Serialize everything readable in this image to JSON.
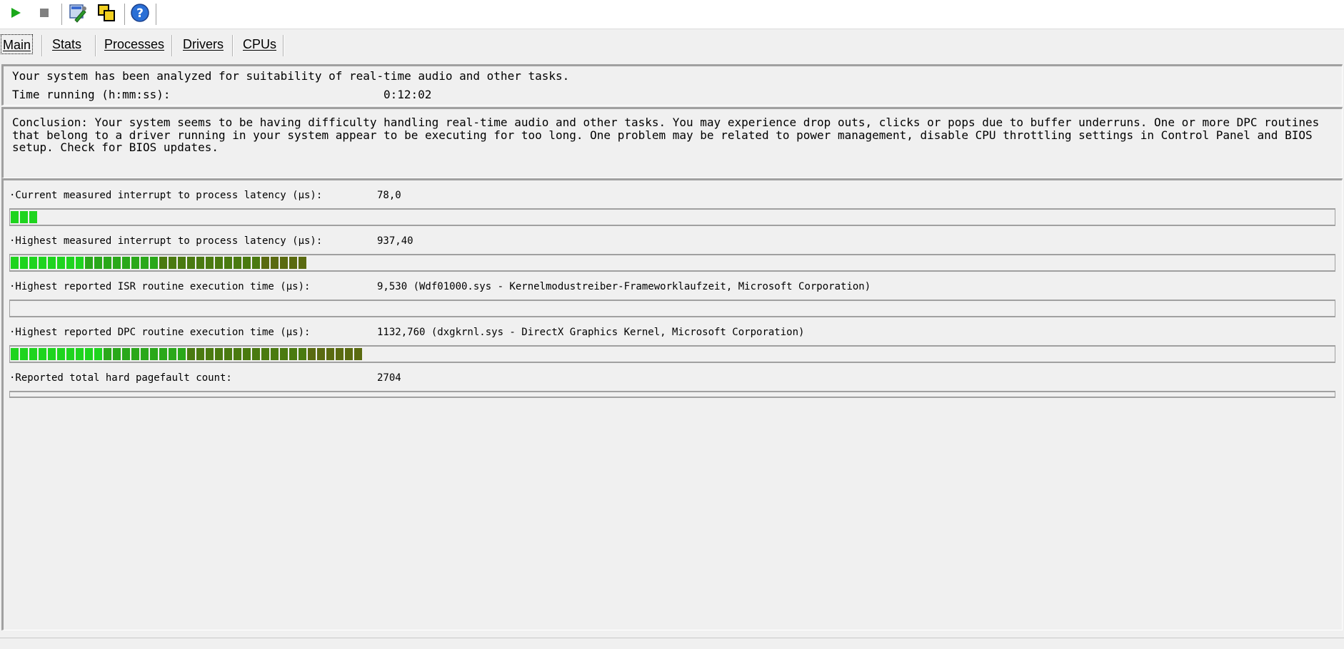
{
  "toolbar": {
    "icons": [
      "play-icon",
      "stop-icon",
      "tools-icon",
      "windows-icon",
      "help-icon"
    ],
    "colors": {
      "play": "#1aa81a",
      "stop": "#808080",
      "help": "#2a6fd6"
    }
  },
  "tabs": [
    {
      "label": "Main",
      "active": true
    },
    {
      "label": "Stats",
      "active": false
    },
    {
      "label": "Processes",
      "active": false
    },
    {
      "label": "Drivers",
      "active": false
    },
    {
      "label": "CPUs",
      "active": false
    }
  ],
  "summary": {
    "analyzed_text": "Your system has been analyzed for suitability of real-time audio and other tasks.",
    "time_running_label": "Time running (h:mm:ss):",
    "time_running_value": "0:12:02"
  },
  "conclusion": "Conclusion: Your system seems to be having difficulty handling real-time audio and other tasks. You may experience drop outs, clicks or pops due to buffer underruns. One or more DPC routines that belong to a driver running in your system appear to be executing for too long. One problem may be related to power management, disable CPU throttling settings in Control Panel and BIOS setup. Check for BIOS updates.",
  "metrics": [
    {
      "label": "·Current measured interrupt to process latency (µs):",
      "value": "78,0",
      "filled_segments": 3
    },
    {
      "label": "·Highest measured interrupt to process latency (µs):",
      "value": "937,40",
      "filled_segments": 32
    },
    {
      "label": "·Highest reported ISR routine execution time (µs):",
      "value": "9,530  (Wdf01000.sys - Kernelmodustreiber-Frameworklaufzeit, Microsoft Corporation)",
      "filled_segments": 0
    },
    {
      "label": "·Highest reported DPC routine execution time (µs):",
      "value": "1132,760  (dxgkrnl.sys - DirectX Graphics Kernel, Microsoft Corporation)",
      "filled_segments": 38
    },
    {
      "label": "·Reported total hard pagefault count:",
      "value": "2704",
      "filled_segments": 0
    }
  ],
  "bar_colors": {
    "green": "#1ed41e",
    "dark_green": "#4a7a10",
    "olive": "#5a6a10"
  }
}
